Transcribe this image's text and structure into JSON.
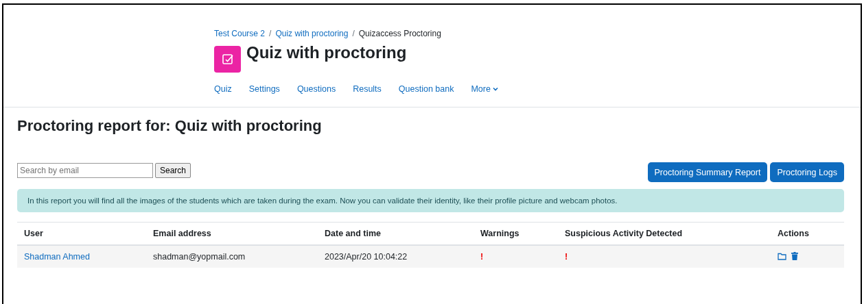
{
  "breadcrumb": [
    {
      "label": "Test Course 2",
      "link": true
    },
    {
      "label": "Quiz with proctoring",
      "link": true
    },
    {
      "label": "Quizaccess Proctoring",
      "link": false
    }
  ],
  "breadcrumb_separator": "/",
  "title": "Quiz with proctoring",
  "nav": [
    {
      "label": "Quiz",
      "dropdown": false
    },
    {
      "label": "Settings",
      "dropdown": false
    },
    {
      "label": "Questions",
      "dropdown": false
    },
    {
      "label": "Results",
      "dropdown": false
    },
    {
      "label": "Question bank",
      "dropdown": false
    },
    {
      "label": "More",
      "dropdown": true
    }
  ],
  "report_title": "Proctoring report for: Quiz with proctoring",
  "search": {
    "placeholder": "Search by email",
    "button": "Search"
  },
  "buttons": [
    "Proctoring Summary Report",
    "Proctoring Logs"
  ],
  "info": "In this report you will find all the images of the students which are taken during the exam. Now you can validate their identity, like their profile picture and webcam photos.",
  "table": {
    "columns": [
      "User",
      "Email address",
      "Date and time",
      "Warnings",
      "Suspicious Activity Detected",
      "Actions"
    ],
    "rows": [
      {
        "user": "Shadman Ahmed",
        "email": "shadman@yopmail.com",
        "datetime": "2023/Apr/20 10:04:22",
        "warnings": "!",
        "suspicious": "!"
      }
    ]
  }
}
